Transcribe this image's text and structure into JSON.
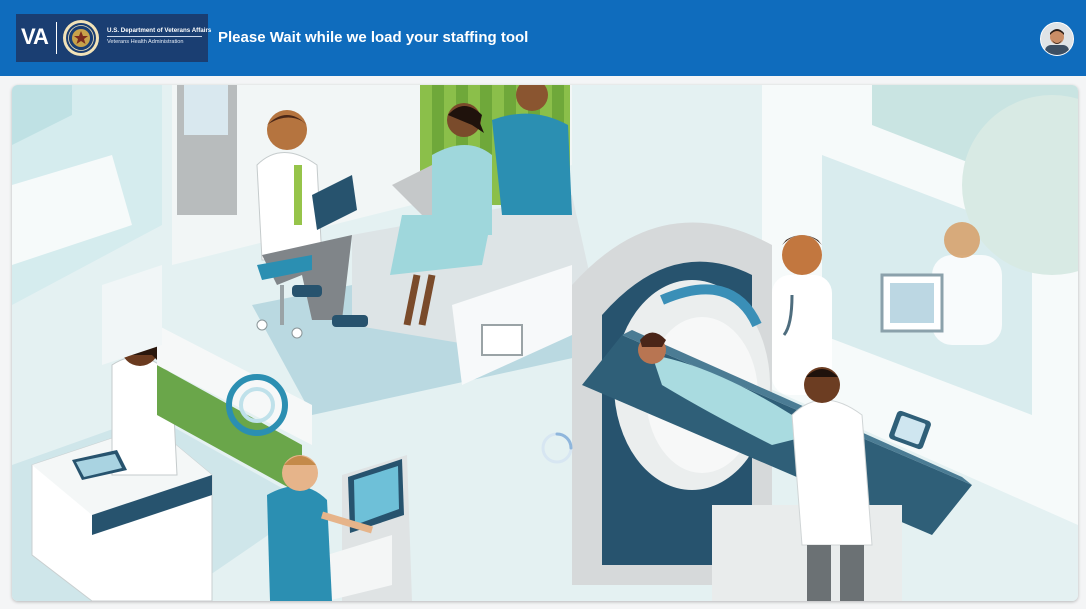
{
  "header": {
    "logo": {
      "abbr": "VA",
      "department": "U.S. Department of Veterans Affairs",
      "administration": "Veterans Health Administration"
    },
    "title": "Please Wait while we load your staffing tool",
    "avatar_icon": "user-avatar"
  },
  "main": {
    "illustration": "hospital-scene-illustration",
    "loading_indicator": "loading-spinner-icon"
  },
  "colors": {
    "header_bg": "#0f6cbd",
    "logo_bg": "#1a3e72",
    "spinner": "#8fb6dc"
  }
}
